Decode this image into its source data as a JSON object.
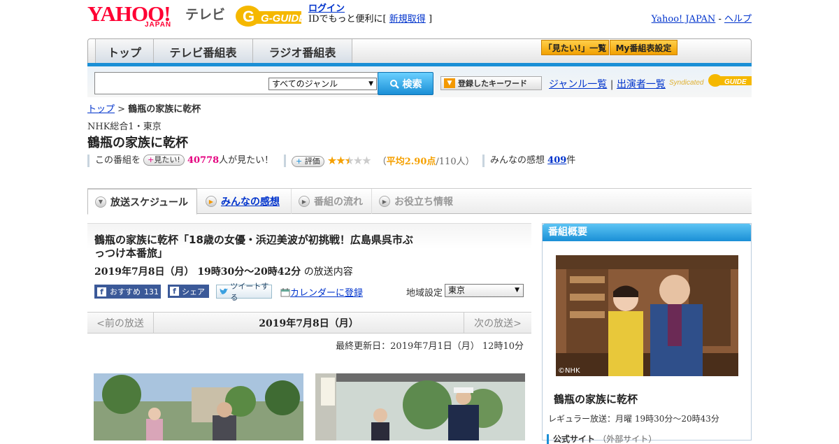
{
  "header": {
    "brand": "YAHOO!",
    "brand_sub": "JAPAN",
    "brand_tv": "テレビ",
    "gguide": "G-GUIDE",
    "login": "ログイン",
    "login_desc_prefix": "IDでもっと便利に[",
    "register": "新規取得",
    "login_desc_suffix": "]",
    "yahoo_japan": "Yahoo! JAPAN",
    "separator": "-",
    "help": "ヘルプ"
  },
  "nav": {
    "tabs": [
      "トップ",
      "テレビ番組表",
      "ラジオ番組表"
    ],
    "wantlist": "「見たい!」一覧",
    "myguide": "My番組表設定"
  },
  "search": {
    "genre": "すべてのジャンル",
    "button": "検索",
    "keywords": "登録したキーワード",
    "genre_list": "ジャンル一覧",
    "divider": "|",
    "cast_list": "出演者一覧",
    "syndicated": "Syndicated"
  },
  "breadcrumb": {
    "top": "トップ",
    "sep": ">",
    "current": "鶴瓶の家族に乾杯"
  },
  "program": {
    "station": "NHK総合1・東京",
    "title": "鶴瓶の家族に乾杯",
    "want_prefix": "この番組を",
    "want_btn": "見たい!",
    "want_count": "40778",
    "want_suffix": "人が見たい！",
    "rate_btn": "評価",
    "rating_open": "（",
    "rating_avg": "平均2.90点",
    "rating_count": "/110人）",
    "rating_value": 2.9,
    "rating_max": 5,
    "review_prefix": "みんなの感想",
    "review_count": "409",
    "review_suffix": "件"
  },
  "subtabs": [
    "放送スケジュール",
    "みんなの感想",
    "番組の流れ",
    "お役立ち情報"
  ],
  "episode": {
    "title": "鶴瓶の家族に乾杯「18歳の女優・浜辺美波が初挑戦！広島県呉市ぶっつけ本番旅」",
    "date": "2019年7月8日（月） 19時30分～20時42分",
    "date_suffix": "の放送内容",
    "fb_recommend": "おすすめ",
    "fb_count": "131",
    "fb_share": "シェア",
    "tweet": "ツイートする",
    "calendar": "カレンダーに登録",
    "region_label": "地域設定",
    "region": "東京"
  },
  "pager": {
    "prev": "<前の放送",
    "current": "2019年7月8日（月）",
    "next": "次の放送>"
  },
  "updated": "最終更新日：2019年7月1日（月） 12時10分",
  "side": {
    "head": "番組概要",
    "photo_credit": "©NHK",
    "title": "鶴瓶の家族に乾杯",
    "regular": "レギュラー放送：月曜 19時30分～20時43分",
    "official": "公式サイト",
    "official_note": "（外部サイト）"
  },
  "colors": {
    "accent": "#1a8fd6",
    "yahoo_red": "#ff0033",
    "link": "#0033cc",
    "pink": "#e4007f",
    "orange": "#f5a000"
  }
}
